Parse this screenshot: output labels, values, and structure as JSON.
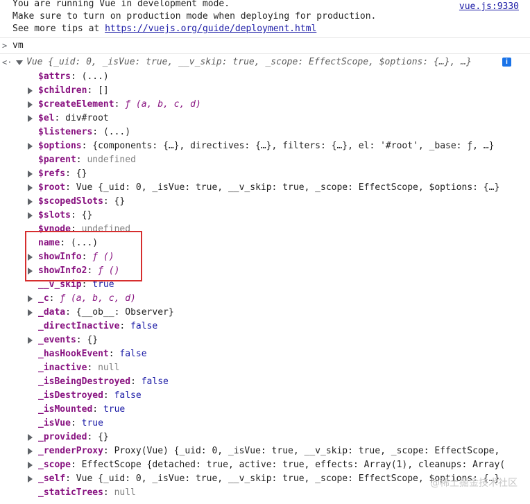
{
  "warning": {
    "line1": "You are running Vue in development mode.",
    "line2": "Make sure to turn on production mode when deploying for production.",
    "line3_prefix": "See more tips at ",
    "line3_link": "https://vuejs.org/guide/deployment.html",
    "source_link": "vue.js:9330"
  },
  "input": {
    "prompt_icon": "chevron-right-icon",
    "command": "vm"
  },
  "result": {
    "return_icon": "return-arrow-icon",
    "summary": "Vue {_uid: 0, _isVue: true, __v_skip: true, _scope: EffectScope, $options: {…}, …}",
    "info_badge": "i"
  },
  "properties": [
    {
      "expandable": false,
      "dim": false,
      "key": "$attrs",
      "value": "(...)",
      "vtype": "obj"
    },
    {
      "expandable": true,
      "dim": false,
      "key": "$children",
      "value": "[]",
      "vtype": "obj"
    },
    {
      "expandable": true,
      "dim": false,
      "key": "$createElement",
      "value": "ƒ (a, b, c, d)",
      "vtype": "sym"
    },
    {
      "expandable": true,
      "dim": false,
      "key": "$el",
      "value": "div#root",
      "vtype": "obj"
    },
    {
      "expandable": false,
      "dim": false,
      "key": "$listeners",
      "value": "(...)",
      "vtype": "obj"
    },
    {
      "expandable": true,
      "dim": false,
      "key": "$options",
      "value": "{components: {…}, directives: {…}, filters: {…}, el: '#root', _base: ƒ, …}",
      "vtype": "obj"
    },
    {
      "expandable": false,
      "dim": false,
      "key": "$parent",
      "value": "undefined",
      "vtype": "muted"
    },
    {
      "expandable": true,
      "dim": false,
      "key": "$refs",
      "value": "{}",
      "vtype": "obj"
    },
    {
      "expandable": true,
      "dim": false,
      "key": "$root",
      "value": "Vue {_uid: 0, _isVue: true, __v_skip: true, _scope: EffectScope, $options: {…}",
      "vtype": "obj"
    },
    {
      "expandable": true,
      "dim": false,
      "key": "$scopedSlots",
      "value": "{}",
      "vtype": "obj"
    },
    {
      "expandable": true,
      "dim": false,
      "key": "$slots",
      "value": "{}",
      "vtype": "obj"
    },
    {
      "expandable": false,
      "dim": false,
      "key": "$vnode",
      "value": "undefined",
      "vtype": "muted"
    },
    {
      "expandable": false,
      "dim": false,
      "key": "name",
      "value": "(...)",
      "vtype": "obj"
    },
    {
      "expandable": true,
      "dim": false,
      "key": "showInfo",
      "value": "ƒ ()",
      "vtype": "sym"
    },
    {
      "expandable": true,
      "dim": false,
      "key": "showInfo2",
      "value": "ƒ ()",
      "vtype": "sym"
    },
    {
      "expandable": false,
      "dim": false,
      "key": "__v_skip",
      "value": "true",
      "vtype": "kw"
    },
    {
      "expandable": true,
      "dim": false,
      "key": "_c",
      "value": "ƒ (a, b, c, d)",
      "vtype": "sym"
    },
    {
      "expandable": true,
      "dim": false,
      "key": "_data",
      "value": "{__ob__: Observer}",
      "vtype": "obj"
    },
    {
      "expandable": false,
      "dim": false,
      "key": "_directInactive",
      "value": "false",
      "vtype": "kw"
    },
    {
      "expandable": true,
      "dim": false,
      "key": "_events",
      "value": "{}",
      "vtype": "obj"
    },
    {
      "expandable": false,
      "dim": false,
      "key": "_hasHookEvent",
      "value": "false",
      "vtype": "kw"
    },
    {
      "expandable": false,
      "dim": false,
      "key": "_inactive",
      "value": "null",
      "vtype": "muted"
    },
    {
      "expandable": false,
      "dim": false,
      "key": "_isBeingDestroyed",
      "value": "false",
      "vtype": "kw"
    },
    {
      "expandable": false,
      "dim": false,
      "key": "_isDestroyed",
      "value": "false",
      "vtype": "kw"
    },
    {
      "expandable": false,
      "dim": false,
      "key": "_isMounted",
      "value": "true",
      "vtype": "kw"
    },
    {
      "expandable": false,
      "dim": false,
      "key": "_isVue",
      "value": "true",
      "vtype": "kw"
    },
    {
      "expandable": true,
      "dim": false,
      "key": "_provided",
      "value": "{}",
      "vtype": "obj"
    },
    {
      "expandable": true,
      "dim": false,
      "key": "_renderProxy",
      "value": "Proxy(Vue) {_uid: 0, _isVue: true, __v_skip: true, _scope: EffectScope,",
      "vtype": "obj"
    },
    {
      "expandable": true,
      "dim": false,
      "key": "_scope",
      "value": "EffectScope {detached: true, active: true, effects: Array(1), cleanups: Array(",
      "vtype": "obj"
    },
    {
      "expandable": true,
      "dim": false,
      "key": "_self",
      "value": "Vue {_uid: 0, _isVue: true, __v_skip: true, _scope: EffectScope, $options: {…}",
      "vtype": "obj"
    },
    {
      "expandable": false,
      "dim": false,
      "key": "_staticTrees",
      "value": "null",
      "vtype": "muted"
    }
  ],
  "watermark": "@稀土掘金技术社区"
}
